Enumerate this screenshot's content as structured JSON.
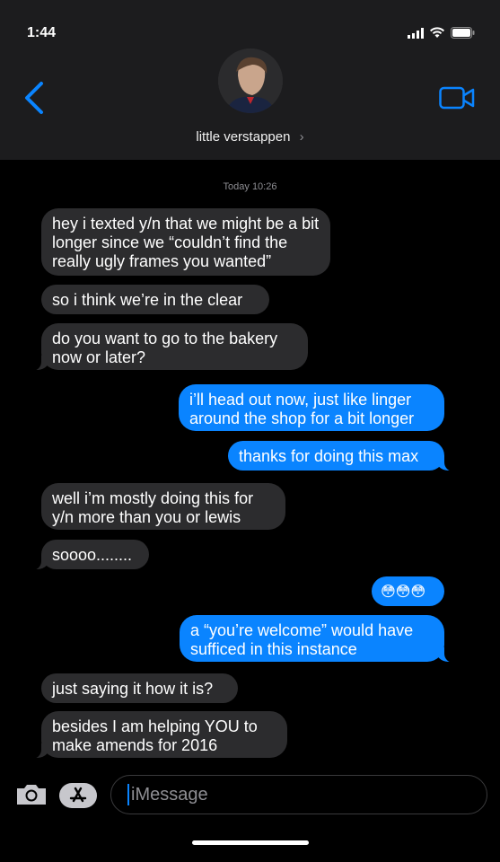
{
  "status_bar": {
    "time": "1:44"
  },
  "contact": {
    "name": "little verstappen"
  },
  "thread": {
    "timestamp": "Today 10:26",
    "messages": [
      {
        "from": "them",
        "text": "hey i texted y/n that we might be a bit longer since we “couldn’t find the really ugly frames you wanted”"
      },
      {
        "from": "them",
        "text": "so i think we’re in the clear"
      },
      {
        "from": "them",
        "text": "do you want to go to the bakery now or later?"
      },
      {
        "from": "me",
        "text": "i’ll head out now, just like linger around the shop for a bit longer"
      },
      {
        "from": "me",
        "text": "thanks for doing this max"
      },
      {
        "from": "them",
        "text": "well i’m mostly doing this for y/n more than you or lewis"
      },
      {
        "from": "them",
        "text": "soooo........"
      },
      {
        "from": "me",
        "text": "😳😳😳"
      },
      {
        "from": "me",
        "text": "a “you’re welcome” would have sufficed in this instance"
      },
      {
        "from": "them",
        "text": "just saying it how it is?"
      },
      {
        "from": "them",
        "text": "besides I am helping YOU to make amends for 2016"
      }
    ]
  },
  "composer": {
    "placeholder": "iMessage"
  },
  "icons": {
    "back": "chevron-left-icon",
    "video": "video-camera-icon",
    "camera": "camera-icon",
    "apps": "app-store-icon"
  },
  "colors": {
    "accent": "#0a84ff",
    "received_bubble": "#2c2c2e",
    "header": "#1c1c1e"
  }
}
